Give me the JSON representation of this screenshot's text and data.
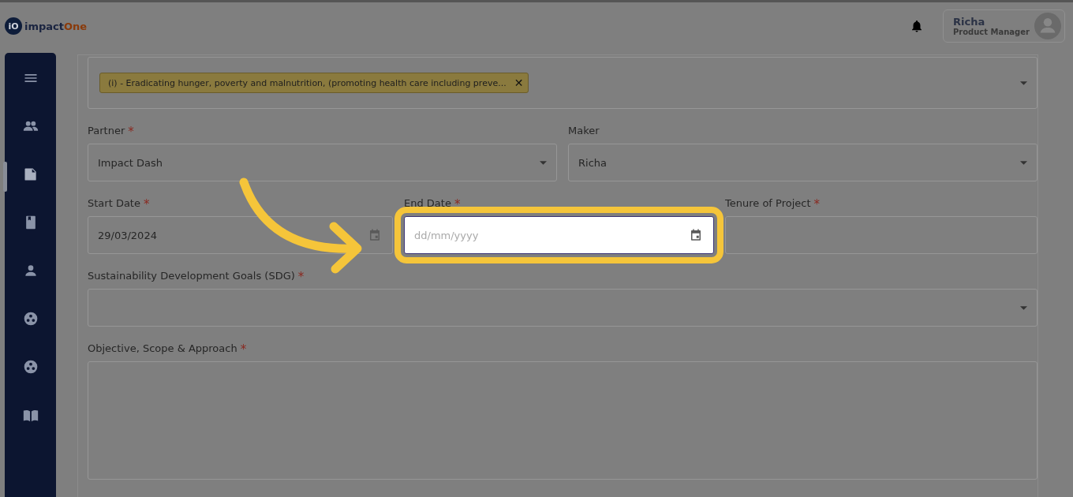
{
  "header": {
    "logo_mark": "iO",
    "logo_main": "impact",
    "logo_accent": "One",
    "user": {
      "name": "Richa",
      "role": "Product Manager"
    }
  },
  "sidebar": {
    "items": [
      {
        "kind": "menu",
        "selected": false
      },
      {
        "kind": "people",
        "selected": false
      },
      {
        "kind": "document",
        "selected": true
      },
      {
        "kind": "book",
        "selected": false
      },
      {
        "kind": "person",
        "selected": false
      },
      {
        "kind": "circles",
        "selected": false
      },
      {
        "kind": "circles",
        "selected": false
      },
      {
        "kind": "reader",
        "selected": false
      }
    ]
  },
  "form": {
    "focus_area": {
      "tags": [
        "(i) - Eradicating hunger, poverty and malnutrition, (promoting health care including preve..."
      ],
      "remove_glyph": "✕"
    },
    "rows": [
      [
        {
          "kind": "select",
          "label": "Partner",
          "required_mark": "*",
          "value": "Impact Dash",
          "highlighted": false
        },
        {
          "kind": "select",
          "label": "Maker",
          "value": "Richa",
          "highlighted": false
        }
      ],
      [
        {
          "kind": "date",
          "label": "Start Date",
          "required_mark": "*",
          "value": "29/03/2024",
          "highlighted": false
        },
        {
          "kind": "date",
          "label": "End Date",
          "required_mark": "*",
          "placeholder": "dd/mm/yyyy",
          "highlighted": true
        },
        {
          "kind": "text",
          "label": "Tenure of Project",
          "required_mark": "*",
          "highlighted": false
        }
      ],
      [
        {
          "kind": "select",
          "label": "Sustainability Development Goals (SDG)",
          "required_mark": "*",
          "highlighted": false
        }
      ],
      [
        {
          "kind": "textarea",
          "label": "Objective, Scope & Approach",
          "required_mark": "*",
          "highlighted": false
        }
      ]
    ]
  }
}
